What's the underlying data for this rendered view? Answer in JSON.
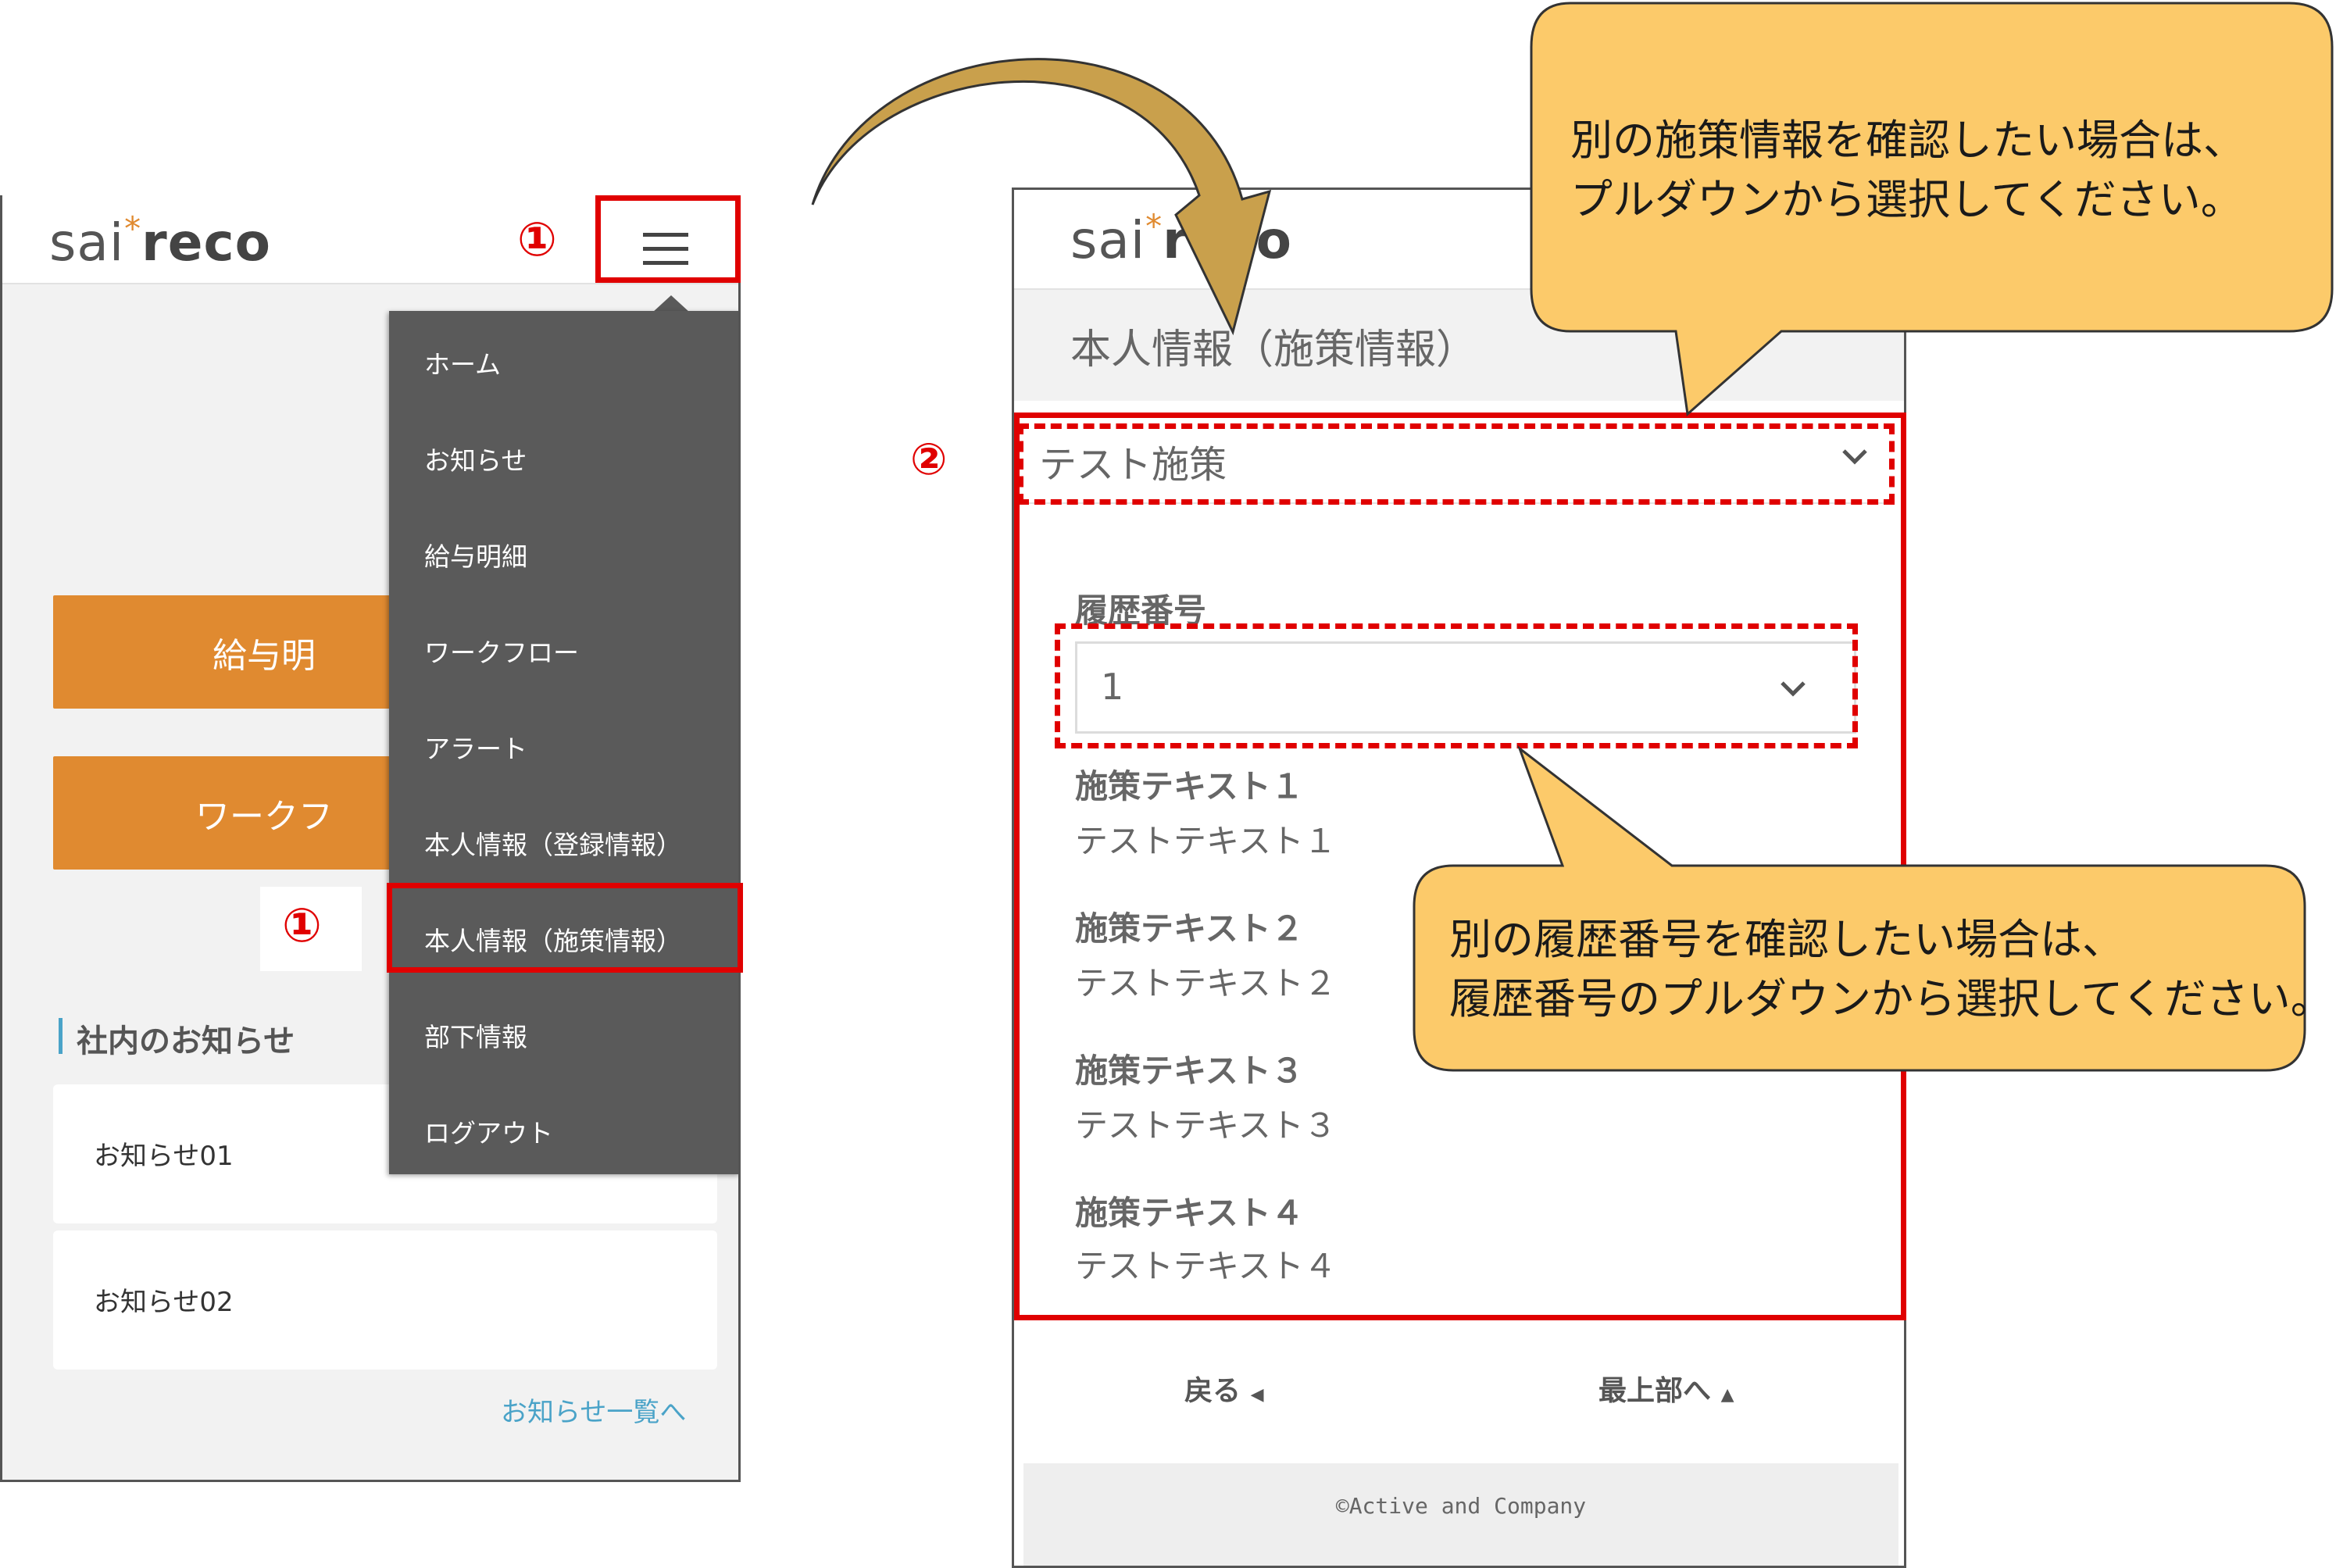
{
  "left_screen": {
    "logo": {
      "sai": "sai",
      "star": "*",
      "reco": "reco"
    },
    "marker_top": "①",
    "marker_menu": "①",
    "orange_buttons": [
      "給与明",
      "ワークフ"
    ],
    "notices_heading": "社内のお知らせ",
    "notices": [
      "お知らせ01",
      "お知らせ02"
    ],
    "notices_link": "お知らせ一覧へ",
    "menu": [
      "ホーム",
      "お知らせ",
      "給与明細",
      "ワークフロー",
      "アラート",
      "本人情報（登録情報）",
      "本人情報（施策情報）",
      "部下情報",
      "ログアウト"
    ]
  },
  "right_screen": {
    "logo": {
      "sai": "sai",
      "star": "*",
      "reco": "reco"
    },
    "page_title": "本人情報（施策情報）",
    "marker": "②",
    "measure_select": "テスト施策",
    "history_label": "履歴番号",
    "history_value": "1",
    "items": [
      {
        "title": "施策テキスト１",
        "value": "テストテキスト１"
      },
      {
        "title": "施策テキスト２",
        "value": "テストテキスト２"
      },
      {
        "title": "施策テキスト３",
        "value": "テストテキスト３"
      },
      {
        "title": "施策テキスト４",
        "value": "テストテキスト４"
      }
    ],
    "back": "戻る",
    "to_top": "最上部へ",
    "copyright": "©Active and Company"
  },
  "callouts": {
    "top": [
      "別の施策情報を確認したい場合は、",
      "プルダウンから選択してください。"
    ],
    "bottom": [
      "別の履歴番号を確認したい場合は、",
      "履歴番号のプルダウンから選択してください。"
    ]
  },
  "colors": {
    "accent_orange": "#e08a30",
    "menu_bg": "#5a5a5a",
    "highlight_red": "#e00000",
    "callout_fill": "#fcca6a",
    "link_blue": "#4aa3c8"
  },
  "icons": [
    "hamburger-icon",
    "chevron-down-icon",
    "chevron-left-icon",
    "chevron-up-icon",
    "curved-arrow-icon"
  ]
}
